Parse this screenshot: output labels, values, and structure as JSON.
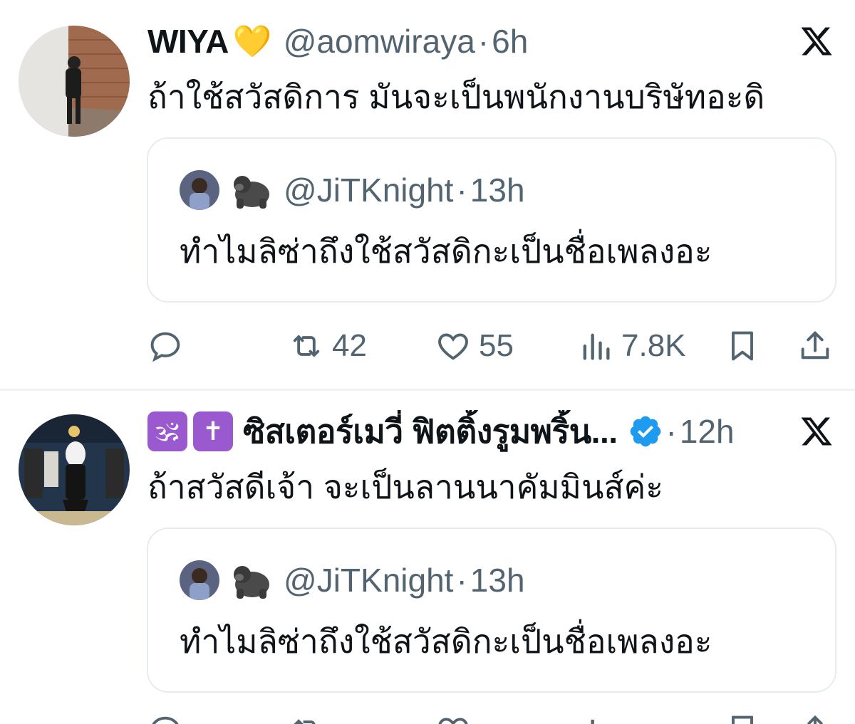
{
  "tweets": [
    {
      "display_name": "WIYA",
      "name_emoji": "💛",
      "handle": "@aomwiraya",
      "time": "6h",
      "text": "ถ้าใช้สวัสดิการ มันจะเป็นพนักงานบริษัทอะดิ",
      "quote": {
        "handle": "@JiTKnight",
        "time": "13h",
        "text": "ทำไมลิซ่าถึงใช้สวัสดิกะเป็นชื่อเพลงอะ"
      },
      "stats": {
        "reposts": "42",
        "likes": "55",
        "views": "7.8K"
      }
    },
    {
      "display_name": "ซิสเตอร์เมวี่ ฟิตติ้งรูมพริ้น...",
      "name_emoji_1": "🕉",
      "name_emoji_2": "✝",
      "time": "12h",
      "verified": true,
      "text": "ถ้าสวัสดีเจ้า จะเป็นลานนาคัมมินส์ค่ะ",
      "quote": {
        "handle": "@JiTKnight",
        "time": "13h",
        "text": "ทำไมลิซ่าถึงใช้สวัสดิกะเป็นชื่อเพลงอะ"
      }
    }
  ],
  "colors": {
    "text": "#0f1419",
    "secondary": "#536471",
    "border": "#e6ecf0",
    "verified": "#1d9bf0"
  }
}
